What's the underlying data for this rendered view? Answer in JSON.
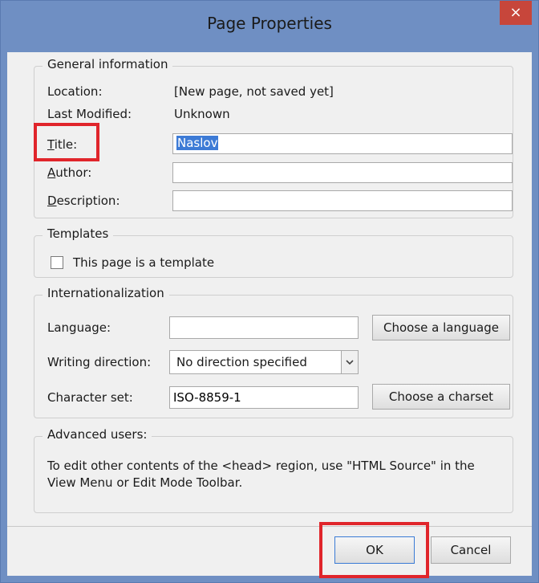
{
  "window": {
    "title": "Page Properties",
    "close_glyph": "×"
  },
  "general": {
    "legend": "General information",
    "location_label": "Location:",
    "location_value": "[New page, not saved yet]",
    "modified_label": "Last Modified:",
    "modified_value": "Unknown",
    "title_label_u": "T",
    "title_label_rest": "itle:",
    "title_value": "Naslov",
    "author_label_u": "A",
    "author_label_rest": "uthor:",
    "author_value": "",
    "description_label_u": "D",
    "description_label_rest": "escription:",
    "description_value": ""
  },
  "templates": {
    "legend": "Templates",
    "checkbox_label": "This page is a template",
    "checked": false
  },
  "i18n": {
    "legend": "Internationalization",
    "language_label": "Language:",
    "language_value": "",
    "choose_language": "Choose a language",
    "direction_label": "Writing direction:",
    "direction_value": "No direction specified",
    "charset_label": "Character set:",
    "charset_value": "ISO-8859-1",
    "choose_charset": "Choose a charset"
  },
  "advanced": {
    "legend": "Advanced users:",
    "text": "To edit other contents of the <head> region, use \"HTML Source\" in the View Menu or Edit Mode Toolbar."
  },
  "buttons": {
    "ok": "OK",
    "cancel": "Cancel"
  },
  "colors": {
    "highlight": "#e0252b",
    "titlebar": "#6f8fc3",
    "selection": "#3d7bd6"
  }
}
